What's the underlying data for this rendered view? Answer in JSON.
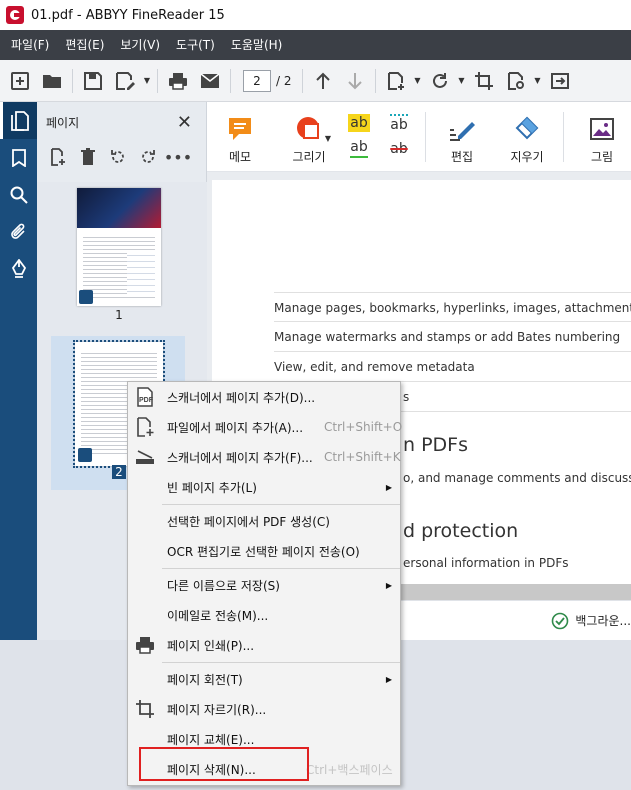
{
  "window": {
    "title": "01.pdf - ABBYY FineReader 15"
  },
  "menubar": {
    "items": [
      "파일(F)",
      "편집(E)",
      "보기(V)",
      "도구(T)",
      "도움말(H)"
    ]
  },
  "toolbar": {
    "page_current": "2",
    "page_total": "/ 2"
  },
  "pages_panel": {
    "title": "페이지",
    "thumbnails": [
      {
        "number": "1"
      },
      {
        "number": "2"
      }
    ]
  },
  "ribbon": {
    "memo": "메모",
    "draw": "그리기",
    "edit": "편집",
    "erase": "지우기",
    "image": "그림",
    "text_tool_ab": "ab"
  },
  "document": {
    "rows": [
      "Manage pages, bookmarks, hyperlinks, images, attachments, headers and footers",
      "Manage watermarks and stamps or add Bates numbering",
      "View, edit, and remove metadata",
      "s"
    ],
    "heading1": "n PDFs",
    "text1": "o, and manage comments and discussions in",
    "heading2": "d protection",
    "text2": "ersonal information in PDFs"
  },
  "status": {
    "text": "백그라운..."
  },
  "context_menu": {
    "items": [
      {
        "label": "스캐너에서 페이지 추가(D)...",
        "shortcut": "",
        "submenu": false,
        "icon": "pdf-scan-icon"
      },
      {
        "label": "파일에서 페이지 추가(A)...",
        "shortcut": "Ctrl+Shift+O",
        "submenu": false,
        "icon": "add-file-icon"
      },
      {
        "label": "스캐너에서 페이지 추가(F)...",
        "shortcut": "Ctrl+Shift+K",
        "submenu": false,
        "icon": "scanner-icon"
      },
      {
        "label": "빈 페이지 추가(L)",
        "shortcut": "",
        "submenu": true,
        "icon": ""
      },
      {
        "label": "선택한 페이지에서 PDF 생성(C)",
        "shortcut": "",
        "submenu": false,
        "icon": ""
      },
      {
        "label": "OCR 편집기로 선택한 페이지 전송(O)",
        "shortcut": "",
        "submenu": false,
        "icon": ""
      },
      {
        "label": "다른 이름으로 저장(S)",
        "shortcut": "",
        "submenu": true,
        "icon": ""
      },
      {
        "label": "이메일로 전송(M)...",
        "shortcut": "",
        "submenu": false,
        "icon": ""
      },
      {
        "label": "페이지 인쇄(P)...",
        "shortcut": "",
        "submenu": false,
        "icon": "print-icon"
      },
      {
        "label": "페이지 회전(T)",
        "shortcut": "",
        "submenu": true,
        "icon": ""
      },
      {
        "label": "페이지 자르기(R)...",
        "shortcut": "",
        "submenu": false,
        "icon": "crop-icon"
      },
      {
        "label": "페이지 교체(E)...",
        "shortcut": "",
        "submenu": false,
        "icon": ""
      },
      {
        "label": "페이지 삭제(N)...",
        "shortcut": "Ctrl+백스페이스",
        "submenu": false,
        "icon": ""
      }
    ]
  },
  "colors": {
    "accent": "#1a4d7c",
    "highlight_box": "#e02020",
    "menubar": "#3b3f46"
  }
}
